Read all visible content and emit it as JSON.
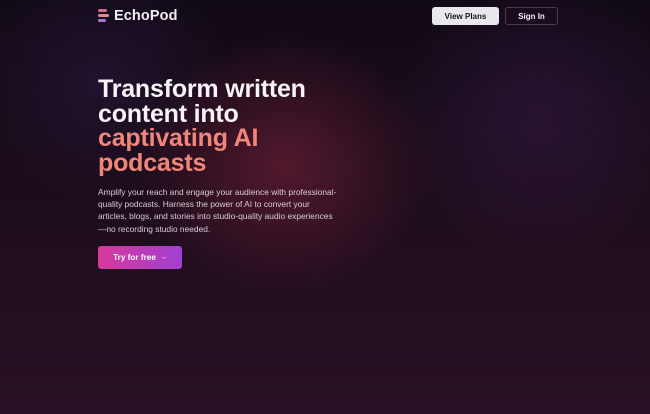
{
  "brand": {
    "name": "EchoPod",
    "icon": "equalizer-bars-icon"
  },
  "nav": {
    "view_plans": "View Plans",
    "sign_in": "Sign In"
  },
  "hero": {
    "headline_lines": [
      "Transform written",
      "content into"
    ],
    "headline_accent_lines": [
      "captivating AI",
      "podcasts"
    ],
    "description": "Amplify your reach and engage your audience with professional-quality podcasts. Harness the power of AI to convert your articles, blogs, and stories into studio-quality audio experiences—no recording studio needed.",
    "cta_label": "Try for free",
    "cta_icon": "arrow-right-icon",
    "cta_arrow": "→"
  },
  "colors": {
    "background": "#150b14",
    "accent_text": "#f0867a",
    "cta_gradient_start": "#d6399a",
    "cta_gradient_end": "#a23fd2",
    "view_plans_bg": "#e9e8ec"
  }
}
